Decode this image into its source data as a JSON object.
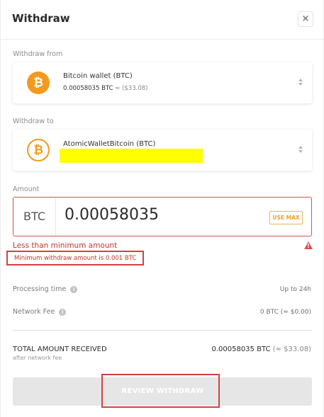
{
  "dialog": {
    "title": "Withdraw",
    "close_glyph": "×"
  },
  "withdraw_from": {
    "label": "Withdraw from",
    "wallet_name": "Bitcoin wallet (BTC)",
    "balance": "0.00058035 BTC",
    "balance_fiat": "≈ ($33.08)",
    "icon": "bitcoin-icon",
    "icon_glyph": "₿"
  },
  "withdraw_to": {
    "label": "Withdraw to",
    "wallet_name": "AtomicWalletBitcoin (BTC)",
    "icon": "bitcoin-outline-icon",
    "icon_glyph": "₿"
  },
  "amount": {
    "label": "Amount",
    "unit": "BTC",
    "value": "0.00058035",
    "use_max_label": "USE MAX",
    "error": "Less than minimum amount",
    "minimum_note": "Minimum withdraw amount is 0.001 BTC"
  },
  "details": {
    "processing_time_label": "Processing time",
    "processing_time_value": "Up to 24h",
    "network_fee_label": "Network Fee",
    "network_fee_value": "0 BTC (≈ $0.00)"
  },
  "total": {
    "label": "TOTAL AMOUNT RECEIVED",
    "sublabel": "after network fee",
    "value": "0.00058035 BTC",
    "value_fiat": "(≈ $33.08)"
  },
  "review_button": {
    "label": "REVIEW WITHDRAW"
  },
  "colors": {
    "bitcoin_orange": "#f39a1e",
    "error_red": "#d64040",
    "highlight_yellow": "#ffff00",
    "use_max_orange": "#f0a030"
  }
}
